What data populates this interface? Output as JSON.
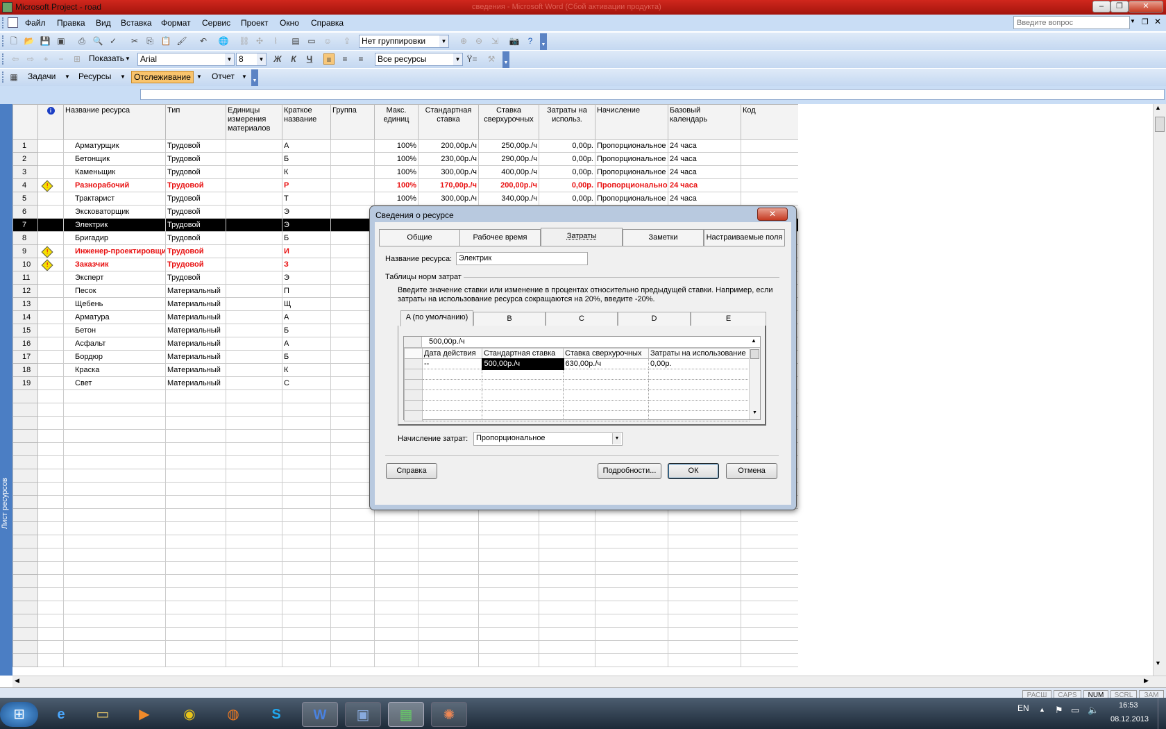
{
  "window": {
    "title": "Microsoft Project - road",
    "ghost_title": "сведения - Microsoft Word (Сбой активации продукта)",
    "ask_placeholder": "Введите вопрос"
  },
  "menu": [
    "Файл",
    "Правка",
    "Вид",
    "Вставка",
    "Формат",
    "Сервис",
    "Проект",
    "Окно",
    "Справка"
  ],
  "toolbar1": {
    "grouping": "Нет группировки"
  },
  "toolbar2": {
    "show": "Показать",
    "font": "Arial",
    "size": "8",
    "bold": "Ж",
    "italic": "К",
    "underline": "Ч",
    "filter": "Все ресурсы"
  },
  "toolbar3": {
    "tasks": "Задачи",
    "resources": "Ресурсы",
    "tracking": "Отслеживание",
    "report": "Отчет"
  },
  "sidebar_label": "Лист ресурсов",
  "columns": [
    "",
    "",
    "Название ресурса",
    "Тип",
    "Единицы измерения материалов",
    "Краткое название",
    "Группа",
    "Макс. единиц",
    "Стандартная ставка",
    "Ставка сверхурочных",
    "Затраты на использ.",
    "Начисление",
    "Базовый календарь",
    "Код"
  ],
  "rows": [
    {
      "id": "1",
      "warn": false,
      "name": "Арматурщик",
      "type": "Трудовой",
      "short": "А",
      "max": "100%",
      "std": "200,00р./ч",
      "ovt": "250,00р./ч",
      "cost": "0,00р.",
      "accrue": "Пропорциональное",
      "cal": "24 часа"
    },
    {
      "id": "2",
      "warn": false,
      "name": "Бетонщик",
      "type": "Трудовой",
      "short": "Б",
      "max": "100%",
      "std": "230,00р./ч",
      "ovt": "290,00р./ч",
      "cost": "0,00р.",
      "accrue": "Пропорциональное",
      "cal": "24 часа"
    },
    {
      "id": "3",
      "warn": false,
      "name": "Каменьщик",
      "type": "Трудовой",
      "short": "К",
      "max": "100%",
      "std": "300,00р./ч",
      "ovt": "400,00р./ч",
      "cost": "0,00р.",
      "accrue": "Пропорциональное",
      "cal": "24 часа"
    },
    {
      "id": "4",
      "warn": true,
      "name": "Разнорабочий",
      "type": "Трудовой",
      "short": "Р",
      "max": "100%",
      "std": "170,00р./ч",
      "ovt": "200,00р./ч",
      "cost": "0,00р.",
      "accrue": "Пропорциональное",
      "cal": "24 часа"
    },
    {
      "id": "5",
      "warn": false,
      "name": "Трактарист",
      "type": "Трудовой",
      "short": "Т",
      "max": "100%",
      "std": "300,00р./ч",
      "ovt": "340,00р./ч",
      "cost": "0,00р.",
      "accrue": "Пропорциональное",
      "cal": "24 часа"
    },
    {
      "id": "6",
      "warn": false,
      "name": "Эксковаторщик",
      "type": "Трудовой",
      "short": "Э",
      "max": "",
      "std": "",
      "ovt": "",
      "cost": "",
      "accrue": "",
      "cal": ""
    },
    {
      "id": "7",
      "warn": false,
      "name": "Электрик",
      "type": "Трудовой",
      "short": "Э",
      "max": "",
      "std": "",
      "ovt": "",
      "cost": "",
      "accrue": "",
      "cal": ""
    },
    {
      "id": "8",
      "warn": false,
      "name": "Бригадир",
      "type": "Трудовой",
      "short": "Б",
      "max": "",
      "std": "",
      "ovt": "",
      "cost": "",
      "accrue": "",
      "cal": ""
    },
    {
      "id": "9",
      "warn": true,
      "name": "Инженер-проектировщик",
      "type": "Трудовой",
      "short": "И",
      "max": "",
      "std": "",
      "ovt": "",
      "cost": "",
      "accrue": "",
      "cal": ""
    },
    {
      "id": "10",
      "warn": true,
      "name": "Заказчик",
      "type": "Трудовой",
      "short": "З",
      "max": "",
      "std": "",
      "ovt": "",
      "cost": "",
      "accrue": "",
      "cal": ""
    },
    {
      "id": "11",
      "warn": false,
      "name": "Эксперт",
      "type": "Трудовой",
      "short": "Э",
      "max": "",
      "std": "",
      "ovt": "",
      "cost": "",
      "accrue": "",
      "cal": ""
    },
    {
      "id": "12",
      "warn": false,
      "name": "Песок",
      "type": "Материальный",
      "short": "П",
      "max": "",
      "std": "",
      "ovt": "",
      "cost": "",
      "accrue": "",
      "cal": ""
    },
    {
      "id": "13",
      "warn": false,
      "name": "Щебень",
      "type": "Материальный",
      "short": "Щ",
      "max": "",
      "std": "",
      "ovt": "",
      "cost": "",
      "accrue": "",
      "cal": ""
    },
    {
      "id": "14",
      "warn": false,
      "name": "Арматура",
      "type": "Материальный",
      "short": "А",
      "max": "",
      "std": "",
      "ovt": "",
      "cost": "",
      "accrue": "",
      "cal": ""
    },
    {
      "id": "15",
      "warn": false,
      "name": "Бетон",
      "type": "Материальный",
      "short": "Б",
      "max": "",
      "std": "",
      "ovt": "",
      "cost": "",
      "accrue": "",
      "cal": ""
    },
    {
      "id": "16",
      "warn": false,
      "name": "Асфальт",
      "type": "Материальный",
      "short": "А",
      "max": "",
      "std": "",
      "ovt": "",
      "cost": "",
      "accrue": "",
      "cal": ""
    },
    {
      "id": "17",
      "warn": false,
      "name": "Бордюр",
      "type": "Материальный",
      "short": "Б",
      "max": "",
      "std": "",
      "ovt": "",
      "cost": "",
      "accrue": "",
      "cal": ""
    },
    {
      "id": "18",
      "warn": false,
      "name": "Краска",
      "type": "Материальный",
      "short": "К",
      "max": "",
      "std": "",
      "ovt": "",
      "cost": "",
      "accrue": "",
      "cal": ""
    },
    {
      "id": "19",
      "warn": false,
      "name": "Свет",
      "type": "Материальный",
      "short": "С",
      "max": "",
      "std": "",
      "ovt": "",
      "cost": "",
      "accrue": "",
      "cal": ""
    }
  ],
  "selected_row": "7",
  "dialog": {
    "title": "Сведения о ресурсе",
    "tabs": [
      "Общие",
      "Рабочее время",
      "Затраты",
      "Заметки",
      "Настраиваемые поля"
    ],
    "active_tab": "Затраты",
    "name_label": "Название ресурса:",
    "name_value": "Электрик",
    "group_label": "Таблицы норм затрат",
    "hint": "Введите значение ставки или изменение в процентах относительно предыдущей ставки. Например, если затраты на использование ресурса сокращаются на 20%, введите -20%.",
    "rate_tabs": [
      "A (по умолчанию)",
      "B",
      "C",
      "D",
      "E"
    ],
    "edit_value": "500,00р./ч",
    "grid_headers": [
      "Дата действия",
      "Стандартная ставка",
      "Ставка сверхурочных",
      "Затраты на использование"
    ],
    "grid_row": [
      "--",
      "500,00р./ч",
      "630,00р./ч",
      "0,00р."
    ],
    "accrual_label": "Начисление затрат:",
    "accrual_value": "Пропорциональное",
    "buttons": {
      "help": "Справка",
      "details": "Подробности...",
      "ok": "ОК",
      "cancel": "Отмена"
    }
  },
  "statusbar": [
    "РАСШ",
    "CAPS",
    "NUM",
    "SCRL",
    "ЗАМ"
  ],
  "tray": {
    "lang": "EN",
    "time": "16:53",
    "date": "08.12.2013"
  },
  "colors": {
    "title_red": "#c0201a",
    "toolbar_blue": "#c9ddf5",
    "warning_red": "#e81010",
    "sidebar_blue": "#4b7ec4"
  }
}
